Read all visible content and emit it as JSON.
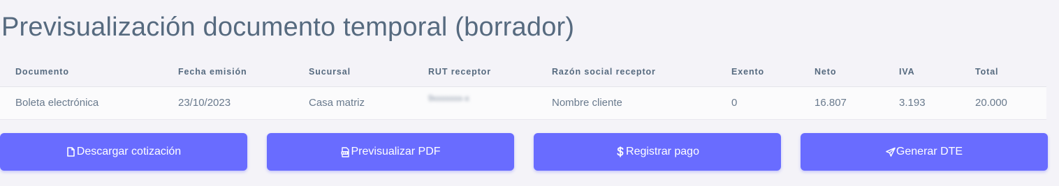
{
  "page": {
    "title": "Previsualización documento temporal (borrador)"
  },
  "table": {
    "headers": [
      "Documento",
      "Fecha emisión",
      "Sucursal",
      "RUT receptor",
      "Razón social receptor",
      "Exento",
      "Neto",
      "IVA",
      "Total"
    ],
    "row": {
      "documento": "Boleta electrónica",
      "fecha_emision": "23/10/2023",
      "sucursal": "Casa matriz",
      "rut_receptor": "9xxxxxxx-x",
      "razon_social": "Nombre cliente",
      "exento": "0",
      "neto": "16.807",
      "iva": "3.193",
      "total": "20.000"
    }
  },
  "actions": {
    "download_quote": {
      "label": "Descargar cotización",
      "icon": "file-icon"
    },
    "preview_pdf": {
      "label": "Previsualizar PDF",
      "icon": "pdf-file-icon"
    },
    "register_payment": {
      "label": "Registrar pago",
      "icon": "dollar-icon"
    },
    "generate_dte": {
      "label": "Generar DTE",
      "icon": "send-icon"
    }
  },
  "colors": {
    "background": "#f4f3f8",
    "primary": "#696cff",
    "text": "#566a7f"
  }
}
